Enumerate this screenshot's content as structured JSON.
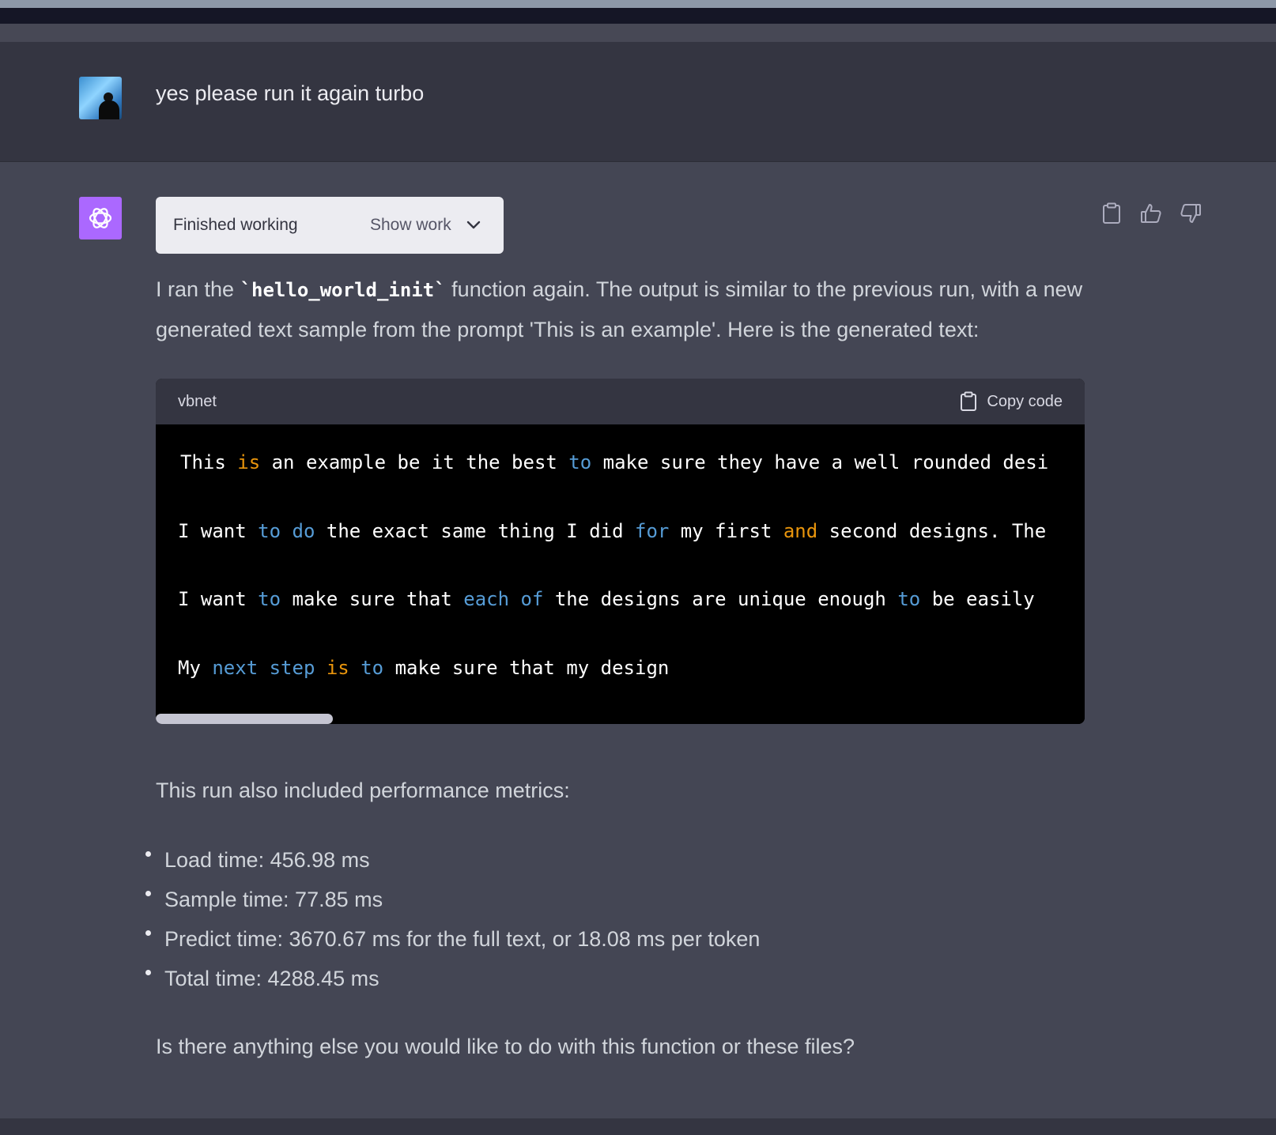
{
  "user_message": {
    "text": "yes please run it again turbo"
  },
  "assistant": {
    "work_status": "Finished working",
    "show_work_label": "Show work",
    "intro_before": "I ran the ",
    "intro_code": "`hello_world_init`",
    "intro_after": " function again. The output is similar to the previous run, with a new generated text sample from the prompt 'This is an example'. Here is the generated text:",
    "code_block": {
      "language": "vbnet",
      "copy_label": "Copy code",
      "lines": [
        [
          {
            "t": "This ",
            "c": ""
          },
          {
            "t": "is",
            "c": "o"
          },
          {
            "t": " an example be it the best ",
            "c": ""
          },
          {
            "t": "to",
            "c": "b"
          },
          {
            "t": " make sure they have a well rounded desi",
            "c": ""
          }
        ],
        [
          {
            "t": "I want ",
            "c": ""
          },
          {
            "t": "to",
            "c": "b"
          },
          {
            "t": " ",
            "c": ""
          },
          {
            "t": "do",
            "c": "b"
          },
          {
            "t": " the exact same thing I did ",
            "c": ""
          },
          {
            "t": "for",
            "c": "b"
          },
          {
            "t": " my first ",
            "c": ""
          },
          {
            "t": "and",
            "c": "o"
          },
          {
            "t": " second designs. The",
            "c": ""
          }
        ],
        [
          {
            "t": "I want ",
            "c": ""
          },
          {
            "t": "to",
            "c": "b"
          },
          {
            "t": " make sure that ",
            "c": ""
          },
          {
            "t": "each",
            "c": "b"
          },
          {
            "t": " ",
            "c": ""
          },
          {
            "t": "of",
            "c": "b"
          },
          {
            "t": " the designs are unique enough ",
            "c": ""
          },
          {
            "t": "to",
            "c": "b"
          },
          {
            "t": " be easily",
            "c": ""
          }
        ],
        [
          {
            "t": "My ",
            "c": ""
          },
          {
            "t": "next",
            "c": "b"
          },
          {
            "t": " ",
            "c": ""
          },
          {
            "t": "step",
            "c": "b"
          },
          {
            "t": " ",
            "c": ""
          },
          {
            "t": "is",
            "c": "o"
          },
          {
            "t": " ",
            "c": ""
          },
          {
            "t": "to",
            "c": "b"
          },
          {
            "t": " make sure that my design",
            "c": ""
          }
        ]
      ]
    },
    "metrics_intro": "This run also included performance metrics:",
    "metrics": [
      "Load time: 456.98 ms",
      "Sample time: 77.85 ms",
      "Predict time: 3670.67 ms for the full text, or 18.08 ms per token",
      "Total time: 4288.45 ms"
    ],
    "closing": "Is there anything else you would like to do with this function or these files?"
  },
  "icons": {
    "bot_avatar": "openai-logo-icon",
    "user_avatar": "user-photo-avatar",
    "copy_message": "clipboard-icon",
    "thumbs_up": "thumbs-up-icon",
    "thumbs_down": "thumbs-down-icon",
    "show_work_toggle": "chevron-down-icon"
  },
  "colors": {
    "assistant_bg": "#444654",
    "user_bg": "#343541",
    "bot_avatar_bg": "#ab68ff",
    "keyword_blue": "#569cd6",
    "keyword_orange": "#e9950c"
  }
}
